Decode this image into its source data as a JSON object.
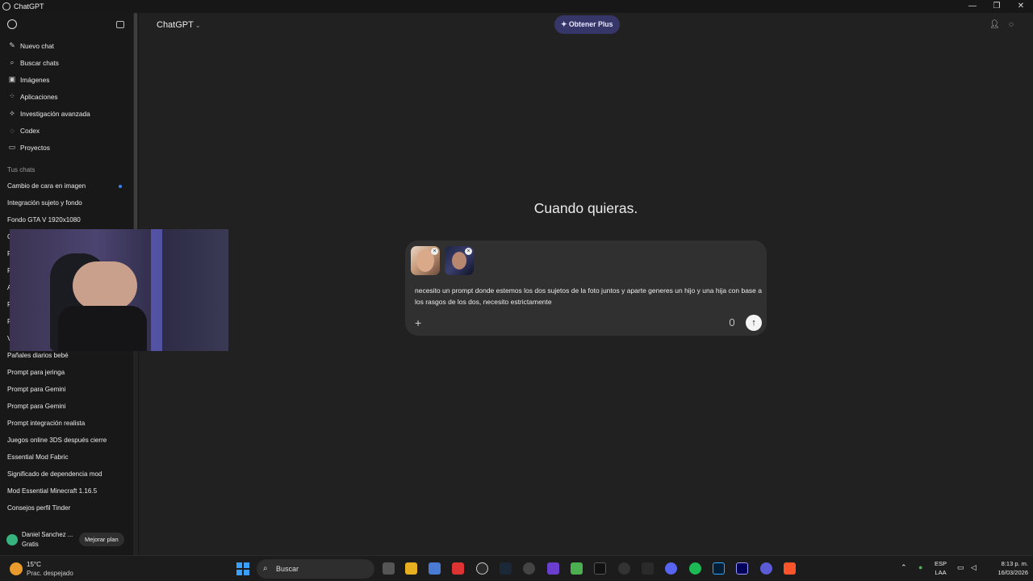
{
  "window": {
    "title": "ChatGPT",
    "controls": [
      "—",
      "❐",
      "✕"
    ]
  },
  "sidebar": {
    "nav": [
      {
        "label": "Nuevo chat",
        "icon": "new-chat-icon",
        "glyph": "✎"
      },
      {
        "label": "Buscar chats",
        "icon": "search-icon",
        "glyph": "⌕"
      },
      {
        "label": "Imágenes",
        "icon": "images-icon",
        "glyph": "▣"
      },
      {
        "label": "Aplicaciones",
        "icon": "apps-icon",
        "glyph": "⁘"
      },
      {
        "label": "Investigación avanzada",
        "icon": "research-icon",
        "glyph": "⟡"
      },
      {
        "label": "Codex",
        "icon": "codex-icon",
        "glyph": "◌"
      },
      {
        "label": "Proyectos",
        "icon": "folder-icon",
        "glyph": "▭"
      }
    ],
    "section_label": "Tus chats",
    "chats": [
      "Cambio de cara en imagen",
      "Integración sujeto y fondo",
      "Fondo GTA V 1920x1080",
      "C",
      "Pr",
      "Fo",
      "A",
      "Pr",
      "Pr",
      "Vi",
      "Pañales diarios bebé",
      "Prompt para jeringa",
      "Prompt para Gemini",
      "Prompt para Gemini",
      "Prompt integración realista",
      "Juegos online 3DS después cierre",
      "Essential Mod Fabric",
      "Significado de dependencia mod",
      "Mod Essential Minecraft 1.16.5",
      "Consejos perfil Tinder"
    ],
    "user": {
      "name": "Daniel Sanchez ...",
      "plan": "Gratis",
      "upgrade_label": "Mejorar plan"
    }
  },
  "header": {
    "model": "ChatGPT",
    "plus_label": "✦ Obtener Plus"
  },
  "main": {
    "headline": "Cuando quieras."
  },
  "composer": {
    "text": "necesito un prompt donde estemos los dos sujetos de la foto juntos y aparte generes un hijo y una hija con base a los rasgos de los dos, necesito estrictamente",
    "attachments": [
      "photo-woman",
      "photo-man"
    ],
    "send_glyph": "↑",
    "add_glyph": "+"
  },
  "taskbar": {
    "weather_temp": "15°C",
    "weather_cond": "Prac. despejado",
    "search_label": "Buscar",
    "lang_line1": "ESP",
    "lang_line2": "LAA",
    "time": "8:13 p. m.",
    "date": "16/03/2026"
  },
  "colors": {
    "accent_plus": "#373669",
    "sidebar_bg": "#181818",
    "main_bg": "#212121",
    "composer_bg": "#303030"
  }
}
